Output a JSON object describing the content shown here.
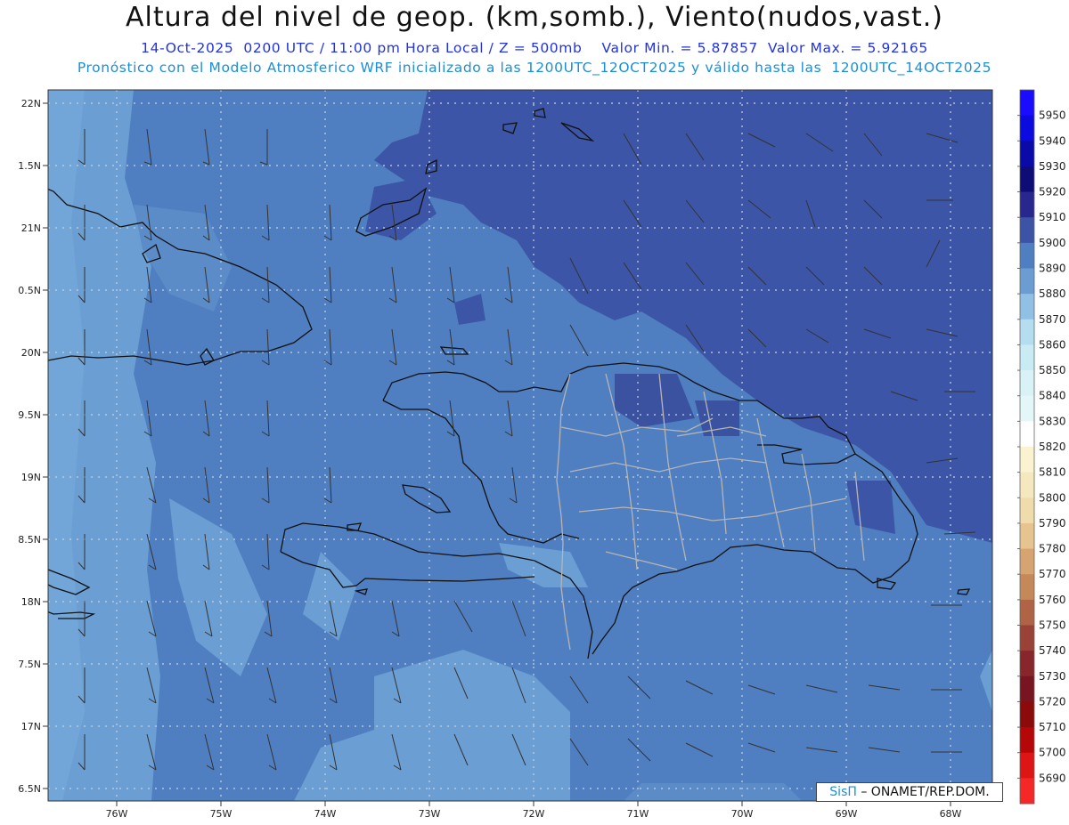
{
  "title": "Altura del nivel de geop. (km,somb.), Viento(nudos,vast.)",
  "subtitle_line1": "14-Oct-2025  0200 UTC / 11:00 pm Hora Local / Z = 500mb    Valor Min. = 5.87857  Valor Max. = 5.92165",
  "subtitle_line2": "Pronóstico con el Modelo Atmosferico WRF inicializado a las 1200UTC_12OCT2025 y válido hasta las  1200UTC_14OCT2025",
  "credit": {
    "brand": "SisΠ",
    "text": " – ONAMET/REP.DOM."
  },
  "map": {
    "lat_labels": [
      "22N",
      "1.5N",
      "21N",
      "0.5N",
      "20N",
      "9.5N",
      "19N",
      "8.5N",
      "18N",
      "7.5N",
      "17N",
      "6.5N"
    ],
    "lon_labels": [
      "76W",
      "75W",
      "74W",
      "73W",
      "72W",
      "71W",
      "70W",
      "69W",
      "68W"
    ],
    "region": "Hispaniola y Caribe central"
  },
  "colorbar": {
    "labels": [
      "5950",
      "5940",
      "5930",
      "5920",
      "5910",
      "5900",
      "5890",
      "5880",
      "5870",
      "5860",
      "5850",
      "5840",
      "5830",
      "5820",
      "5810",
      "5800",
      "5790",
      "5780",
      "5770",
      "5760",
      "5750",
      "5740",
      "5730",
      "5720",
      "5710",
      "5700",
      "5690"
    ],
    "colors": [
      "#1a0dff",
      "#0b0be0",
      "#0a0aa8",
      "#0d0d75",
      "#27278d",
      "#3c53a6",
      "#4f7fc0",
      "#6b9dd2",
      "#91c0e5",
      "#b4def0",
      "#c9ecf4",
      "#d8f2f6",
      "#e4f7f8",
      "#ffffff",
      "#fbf3d0",
      "#f6e8be",
      "#f0dcab",
      "#e6c48f",
      "#d6a470",
      "#c58959",
      "#b06446",
      "#9a4237",
      "#87262b",
      "#781520",
      "#8b0a0a",
      "#b50707",
      "#dd1515",
      "#f52828"
    ],
    "fill_colors": {
      "deep": "#3b57a6",
      "mid": "#4e7ebf",
      "light": "#6b9ed2"
    }
  }
}
